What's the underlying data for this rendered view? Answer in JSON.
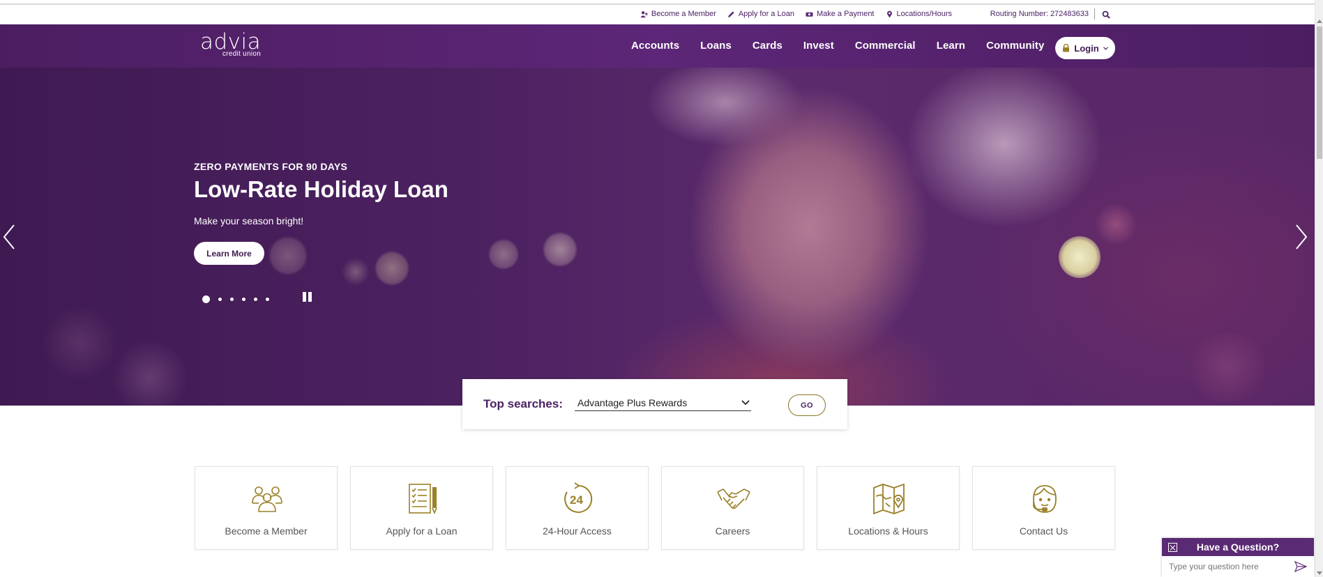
{
  "utility": {
    "links": [
      {
        "label": "Become a Member",
        "icon": "user-plus-icon"
      },
      {
        "label": "Apply for a Loan",
        "icon": "pen-icon"
      },
      {
        "label": "Make a Payment",
        "icon": "money-icon"
      },
      {
        "label": "Locations/Hours",
        "icon": "map-pin-icon"
      }
    ],
    "routing_number": "Routing Number: 272483633"
  },
  "header": {
    "logo_word": "advia",
    "logo_sub": "credit union",
    "nav": [
      "Accounts",
      "Loans",
      "Cards",
      "Invest",
      "Commercial",
      "Learn",
      "Community"
    ],
    "login_label": "Login"
  },
  "hero": {
    "eyebrow": "ZERO PAYMENTS FOR 90 DAYS",
    "title": "Low-Rate Holiday Loan",
    "subtitle": "Make your season bright!",
    "cta_label": "Learn More",
    "slides_count": 6,
    "active_slide": 1
  },
  "search": {
    "label": "Top searches:",
    "selected": "Advantage Plus Rewards",
    "go_label": "GO"
  },
  "tiles": [
    {
      "label": "Become a Member",
      "icon": "members-icon"
    },
    {
      "label": "Apply for a Loan",
      "icon": "application-icon"
    },
    {
      "label": "24-Hour Access",
      "icon": "24-hour-icon"
    },
    {
      "label": "Careers",
      "icon": "handshake-icon"
    },
    {
      "label": "Locations & Hours",
      "icon": "map-icon"
    },
    {
      "label": "Contact Us",
      "icon": "headset-icon"
    }
  ],
  "tile_24_text": "24",
  "chat": {
    "title": "Have a Question?",
    "placeholder": "Type your question here"
  },
  "colors": {
    "brand_purple": "#5b2a74",
    "gold": "#9a8028"
  }
}
